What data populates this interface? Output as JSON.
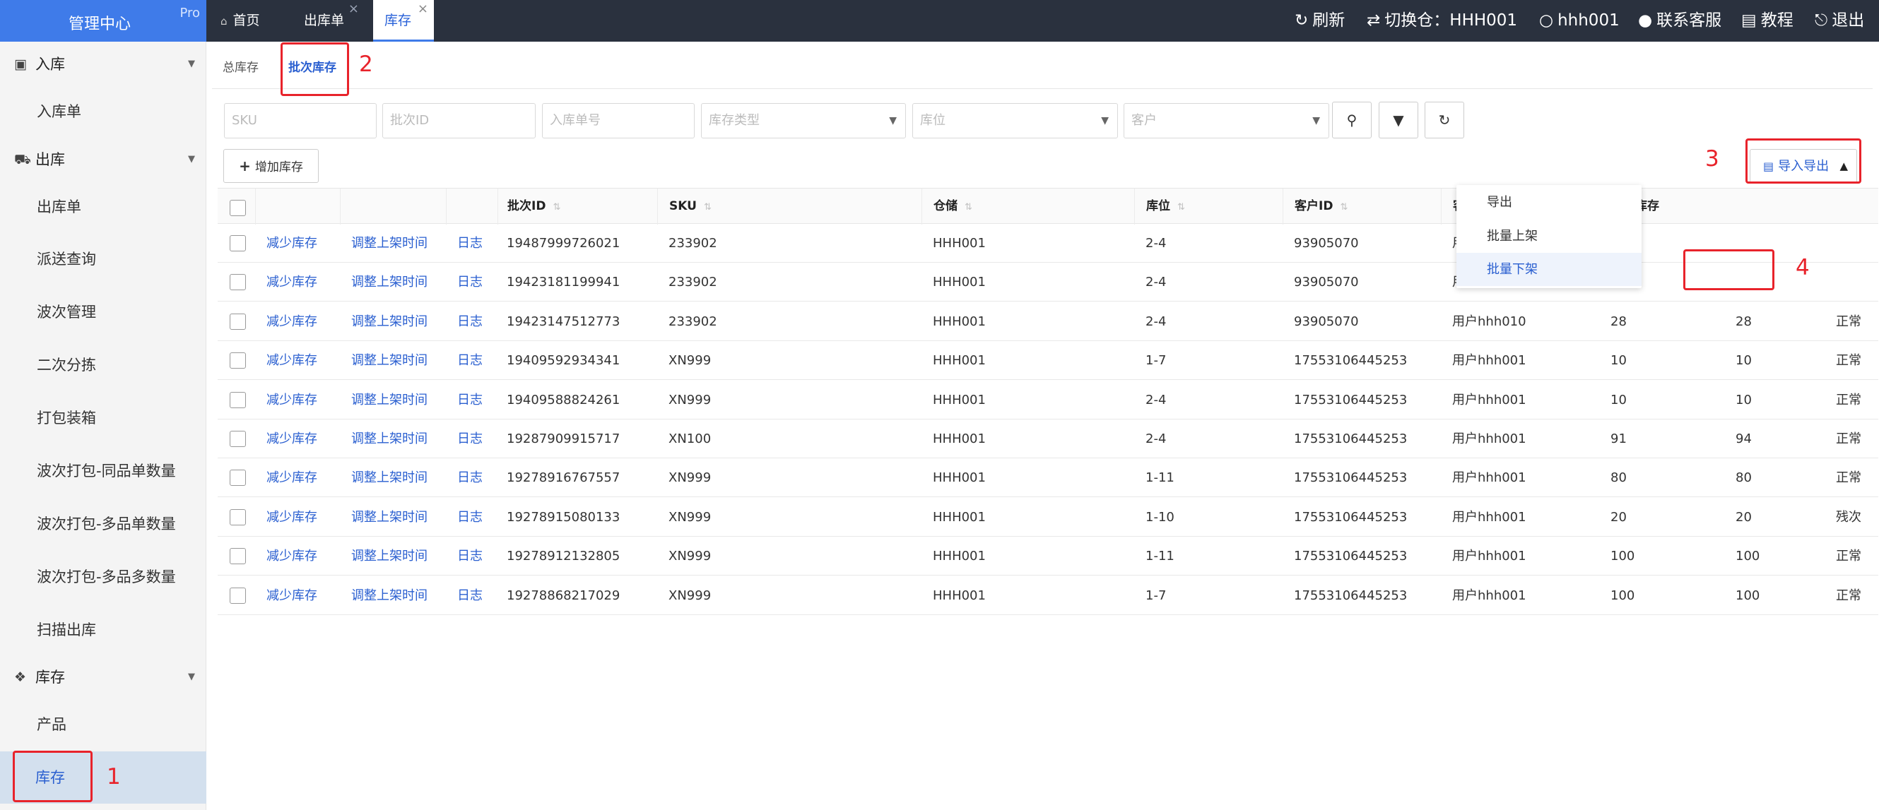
{
  "brand": {
    "title": "管理中心",
    "badge": "Pro"
  },
  "tabs": [
    {
      "label": "首页",
      "icon": "home-icon"
    },
    {
      "label": "出库单",
      "closable": true
    },
    {
      "label": "库存",
      "closable": true,
      "active": true
    }
  ],
  "toolbar": {
    "refresh": "刷新",
    "warehouse": "切换仓：HHH001",
    "user": "hhh001",
    "support": "联系客服",
    "tutorial": "教程",
    "logout": "退出"
  },
  "sidebar": {
    "inbound": {
      "label": "入库",
      "items": [
        "入库单"
      ]
    },
    "outbound": {
      "label": "出库",
      "items": [
        "出库单",
        "派送查询",
        "波次管理",
        "二次分拣",
        "打包装箱",
        "波次打包-同品单数量",
        "波次打包-多品单数量",
        "波次打包-多品多数量",
        "扫描出库"
      ]
    },
    "inventory": {
      "label": "库存",
      "items": [
        "产品",
        "库存"
      ],
      "active_item": "库存"
    }
  },
  "subtabs": [
    "总库存",
    "批次库存"
  ],
  "filters": {
    "sku": "SKU",
    "batch_id": "批次ID",
    "inbound_no": "入库单号",
    "inventory_type": "库存类型",
    "location": "库位",
    "customer": "客户"
  },
  "actions": {
    "add": "增加库存",
    "import_export": "导入导出",
    "menu": [
      "导出",
      "批量上架",
      "批量下架"
    ]
  },
  "table": {
    "columns": [
      "批次ID",
      "SKU",
      "仓储",
      "库位",
      "客户ID",
      "客户",
      "可用库存"
    ],
    "row_actions": [
      "减少库存",
      "调整上架时间",
      "日志"
    ],
    "rows": [
      [
        "19487999726021",
        "233902",
        "HHH001",
        "2-4",
        "93905070",
        "用户hhh010",
        "20",
        "",
        ""
      ],
      [
        "19423181199941",
        "233902",
        "HHH001",
        "2-4",
        "93905070",
        "用户hhh010",
        "100",
        "",
        ""
      ],
      [
        "19423147512773",
        "233902",
        "HHH001",
        "2-4",
        "93905070",
        "用户hhh010",
        "28",
        "28",
        "正常"
      ],
      [
        "19409592934341",
        "XN999",
        "HHH001",
        "1-7",
        "17553106445253",
        "用户hhh001",
        "10",
        "10",
        "正常"
      ],
      [
        "19409588824261",
        "XN999",
        "HHH001",
        "2-4",
        "17553106445253",
        "用户hhh001",
        "10",
        "10",
        "正常"
      ],
      [
        "19287909915717",
        "XN100",
        "HHH001",
        "2-4",
        "17553106445253",
        "用户hhh001",
        "91",
        "94",
        "正常"
      ],
      [
        "19278916767557",
        "XN999",
        "HHH001",
        "1-11",
        "17553106445253",
        "用户hhh001",
        "80",
        "80",
        "正常"
      ],
      [
        "19278915080133",
        "XN999",
        "HHH001",
        "1-10",
        "17553106445253",
        "用户hhh001",
        "20",
        "20",
        "残次"
      ],
      [
        "19278912132805",
        "XN999",
        "HHH001",
        "1-11",
        "17553106445253",
        "用户hhh001",
        "100",
        "100",
        "正常"
      ],
      [
        "19278868217029",
        "XN999",
        "HHH001",
        "1-7",
        "17553106445253",
        "用户hhh001",
        "100",
        "100",
        "正常"
      ]
    ]
  },
  "annotations": [
    "1",
    "2",
    "3",
    "4"
  ],
  "colors": {
    "brand": "#3f7be9",
    "topbar": "#2a313e",
    "link": "#2a5fd0",
    "annotation": "#e8232b"
  }
}
